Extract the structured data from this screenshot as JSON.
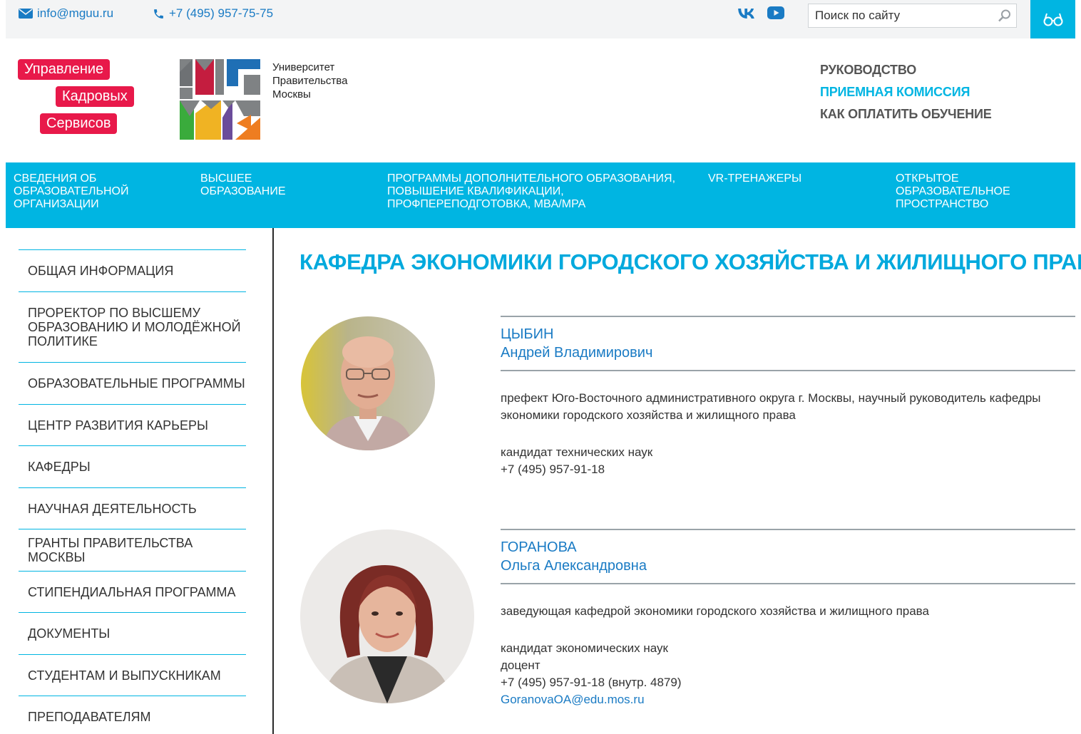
{
  "topbar": {
    "email": "info@mguu.ru",
    "phone": "+7 (495) 957-75-75",
    "social": [
      "vk-icon",
      "youtube-icon"
    ],
    "search_placeholder": "Поиск по сайту",
    "accessibility_icon": "glasses-icon"
  },
  "header": {
    "ukcs_logo": [
      "Управление",
      "Кадровых",
      "Сервисов"
    ],
    "university_name": [
      "Университет",
      "Правительства",
      "Москвы"
    ],
    "top_links": [
      {
        "label": "РУКОВОДСТВО",
        "color": "#555555"
      },
      {
        "label": "ПРИЕМНАЯ КОМИССИЯ",
        "color": "#00b5e2"
      },
      {
        "label": "КАК ОПЛАТИТЬ ОБУЧЕНИЕ",
        "color": "#555555"
      }
    ]
  },
  "main_nav": [
    "СВЕДЕНИЯ ОБ\nОБРАЗОВАТЕЛЬНОЙ\nОРГАНИЗАЦИИ",
    "ВЫСШЕЕ\nОБРАЗОВАНИЕ",
    "ПРОГРАММЫ ДОПОЛНИТЕЛЬНОГО ОБРАЗОВАНИЯ,\nПОВЫШЕНИЕ КВАЛИФИКАЦИИ,\nПРОФПЕРЕПОДГОТОВКА, MBA/MPA",
    "VR-ТРЕНАЖЕРЫ",
    "ОТКРЫТОЕ\nОБРАЗОВАТЕЛЬНОЕ\nПРОСТРАНСТВО"
  ],
  "sidebar": [
    "ОБЩАЯ ИНФОРМАЦИЯ",
    "ПРОРЕКТОР ПО ВЫСШЕМУ ОБРАЗОВАНИЮ И МОЛОДЁЖНОЙ ПОЛИТИКЕ",
    "ОБРАЗОВАТЕЛЬНЫЕ ПРОГРАММЫ",
    "ЦЕНТР РАЗВИТИЯ КАРЬЕРЫ",
    "КАФЕДРЫ",
    "НАУЧНАЯ ДЕЯТЕЛЬНОСТЬ",
    "ГРАНТЫ ПРАВИТЕЛЬСТВА МОСКВЫ",
    "СТИПЕНДИАЛЬНАЯ ПРОГРАММА",
    "ДОКУМЕНТЫ",
    "СТУДЕНТАМ И ВЫПУСКНИКАМ",
    "ПРЕПОДАВАТЕЛЯМ"
  ],
  "page_title": "КАФЕДРА ЭКОНОМИКИ ГОРОДСКОГО ХОЗЯЙСТВА И ЖИЛИЩНОГО ПРАВА",
  "people": [
    {
      "surname": "ЦЫБИН",
      "given_name": "Андрей Владимирович",
      "position": "префект Юго-Восточного административного округа г. Москвы, научный руководитель кафедры экономики городского хозяйства и жилищного права",
      "details": [
        "кандидат технических наук",
        "+7 (495) 957-91-18"
      ],
      "email": ""
    },
    {
      "surname": "ГОРАНОВА",
      "given_name": "Ольга Александровна",
      "position": "заведующая кафедрой экономики городского хозяйства и жилищного права",
      "details": [
        "кандидат экономических наук",
        "доцент",
        "+7 (495) 957-91-18 (внутр. 4879)"
      ],
      "email": "GoranovaOA@edu.mos.ru"
    }
  ],
  "colors": {
    "accent": "#00b5e2",
    "link": "#1a7bc4",
    "ukcs_red": "#e8194a"
  }
}
